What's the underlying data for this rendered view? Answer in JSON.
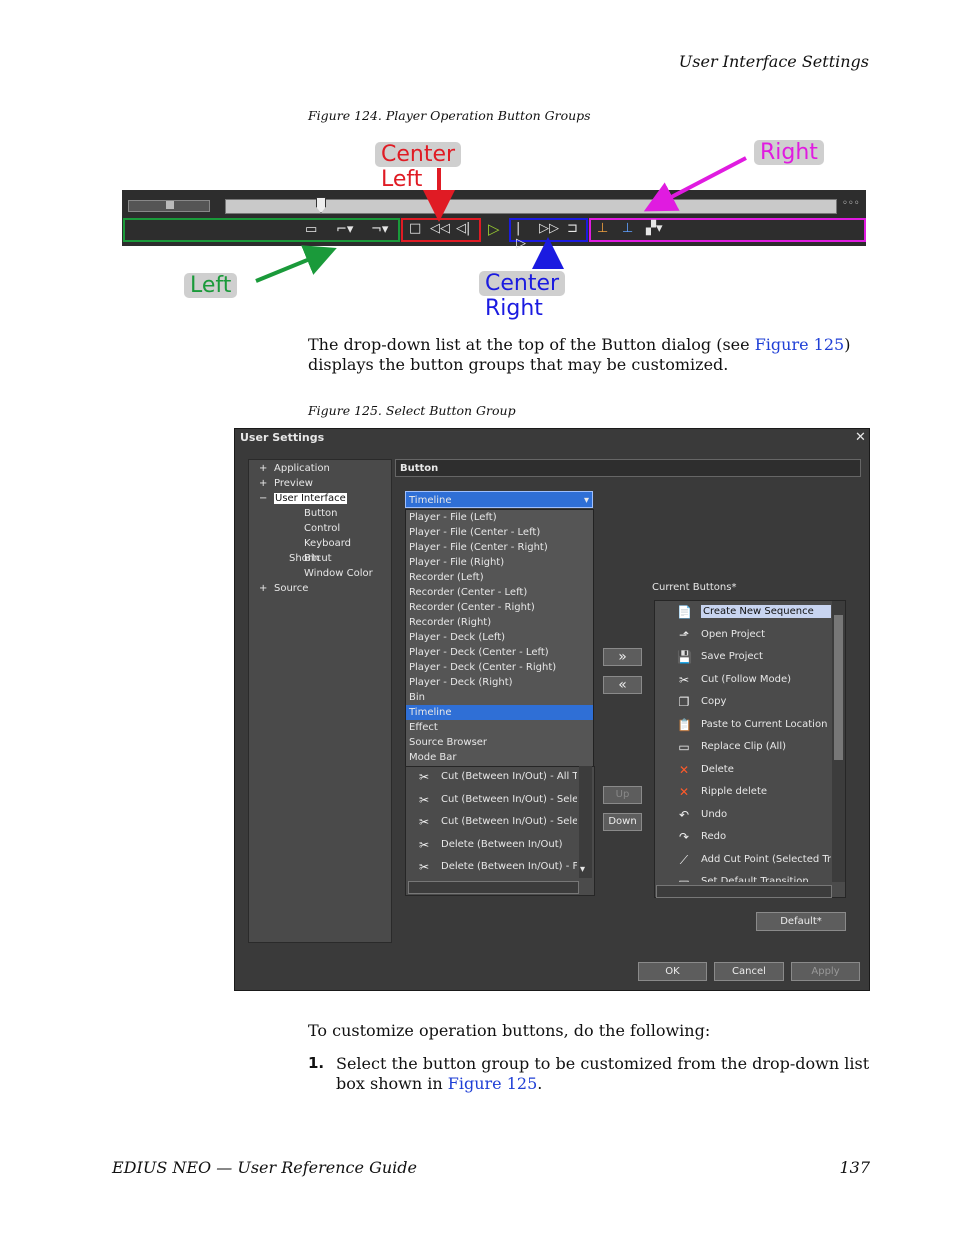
{
  "header": {
    "section_title": "User Interface Settings"
  },
  "figure124": {
    "caption": "Figure 124.  Player Operation Button Groups",
    "labels": {
      "center_left": "Center Left",
      "right": "Right",
      "left": "Left",
      "center_right": "Center Right"
    },
    "colors": {
      "left": "#1a9a3a",
      "center_left": "#e01b24",
      "center_right": "#1b1be0",
      "right": "#e01be0",
      "label_bg": "#c8c8c8"
    }
  },
  "para1": {
    "before": "The drop-down list at the top of the Button dialog (see ",
    "link": "Figure 125",
    "after": ") displays the button groups that may be customized."
  },
  "figure125": {
    "caption": "Figure 125.  Select Button Group",
    "dialog_title": "User Settings",
    "close_glyph": "✕",
    "tree": [
      {
        "prefix": "+",
        "label": "Application"
      },
      {
        "prefix": "+",
        "label": "Preview"
      },
      {
        "prefix": "−",
        "label": "User Interface"
      },
      {
        "prefix": "",
        "label": "Button"
      },
      {
        "prefix": "",
        "label": "Control"
      },
      {
        "prefix": "",
        "label": "Keyboard Shortcut"
      },
      {
        "prefix": "",
        "label": "Bin"
      },
      {
        "prefix": "",
        "label": "Window Color"
      },
      {
        "prefix": "+",
        "label": "Source"
      }
    ],
    "section_header": "Button",
    "dropdown_selected": "Timeline",
    "dropdown_options": [
      "Player - File (Left)",
      "Player - File (Center - Left)",
      "Player - File (Center - Right)",
      "Player - File (Right)",
      "Recorder (Left)",
      "Recorder (Center - Left)",
      "Recorder (Center - Right)",
      "Recorder (Right)",
      "Player - Deck (Left)",
      "Player - Deck (Center - Left)",
      "Player - Deck (Center - Right)",
      "Player - Deck (Right)",
      "Bin",
      "Timeline",
      "Effect",
      "Source Browser",
      "Mode Bar"
    ],
    "available_items": [
      "Cut (Between In/Out) - All Tra",
      "Cut (Between In/Out) - Select",
      "Cut (Between In/Out) - Select",
      "Delete (Between In/Out)",
      "Delete (Between In/Out) - Fol"
    ],
    "current_buttons_label": "Current Buttons*",
    "current_buttons": [
      {
        "label": "Create New Sequence",
        "icon": "📄"
      },
      {
        "label": "Open Project",
        "icon": "⬏"
      },
      {
        "label": "Save Project",
        "icon": "💾"
      },
      {
        "label": "Cut (Follow Mode)",
        "icon": "✂"
      },
      {
        "label": "Copy",
        "icon": "❐"
      },
      {
        "label": "Paste to Current Location",
        "icon": "📋"
      },
      {
        "label": "Replace Clip (All)",
        "icon": "▭"
      },
      {
        "label": "Delete",
        "icon": "✕"
      },
      {
        "label": "Ripple delete",
        "icon": "✕"
      },
      {
        "label": "Undo",
        "icon": "↶"
      },
      {
        "label": "Redo",
        "icon": "↷"
      },
      {
        "label": "Add Cut Point (Selected Trac",
        "icon": "⟋"
      },
      {
        "label": "Set Default Transition",
        "icon": "▭"
      }
    ],
    "buttons": {
      "add": "»",
      "remove": "«",
      "up": "Up",
      "down": "Down",
      "default": "Default*",
      "ok": "OK",
      "cancel": "Cancel",
      "apply": "Apply"
    }
  },
  "para2": {
    "text": "To customize operation buttons, do the following:"
  },
  "step1": {
    "number": "1.",
    "before": "Select the button group to be customized from the drop-down list box shown in ",
    "link": "Figure 125",
    "after": "."
  },
  "footer": {
    "guide": "EDIUS NEO  —  User Reference Guide",
    "page": "137"
  }
}
